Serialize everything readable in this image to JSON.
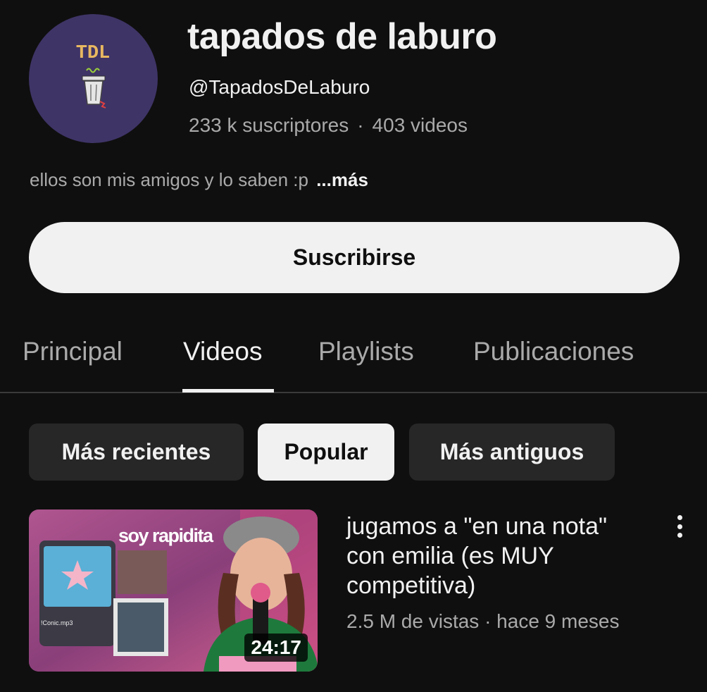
{
  "channel": {
    "name": "tapados de laburo",
    "handle": "@TapadosDeLaburo",
    "subscribers": "233 k suscriptores",
    "separator": "·",
    "videos_count": "403 videos",
    "description": "ellos son mis amigos y lo saben :p",
    "more_label": "...más",
    "avatar": {
      "text": "TDL",
      "background": "#3f3466",
      "icon": "trash-can-icon"
    }
  },
  "subscribe_label": "Suscribirse",
  "tabs": [
    {
      "label": "Principal",
      "active": false
    },
    {
      "label": "Videos",
      "active": true
    },
    {
      "label": "Playlists",
      "active": false
    },
    {
      "label": "Publicaciones",
      "active": false
    }
  ],
  "filters": [
    {
      "label": "Más recientes",
      "selected": false
    },
    {
      "label": "Popular",
      "selected": true
    },
    {
      "label": "Más antiguos",
      "selected": false
    }
  ],
  "videos": [
    {
      "title": "jugamos a \"en una nota\" con emilia (es MUY competitiva)",
      "meta": "2.5 M de vistas · hace 9 meses",
      "duration": "24:17",
      "thumbnail_caption": "soy rapidita",
      "thumbnail_track": "!Conic.mp3"
    }
  ],
  "colors": {
    "background": "#0f0f0f",
    "text_primary": "#f1f1f1",
    "text_secondary": "#aaaaaa",
    "chip": "#272727"
  }
}
